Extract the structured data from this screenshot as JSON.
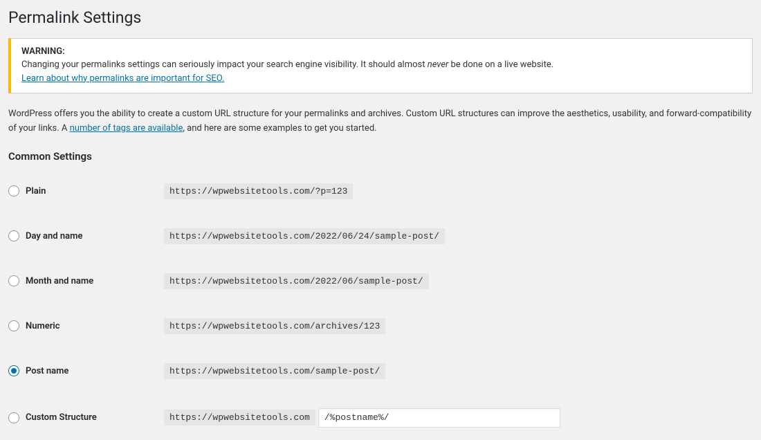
{
  "page_title": "Permalink Settings",
  "notice": {
    "title": "WARNING:",
    "body_before": "Changing your permalinks settings can seriously impact your search engine visibility. It should almost ",
    "body_em": "never",
    "body_after": " be done on a live website.",
    "link_text": "Learn about why permalinks are important for SEO."
  },
  "intro": {
    "before": "WordPress offers you the ability to create a custom URL structure for your permalinks and archives. Custom URL structures can improve the aesthetics, usability, and forward-compatibility of your links. A ",
    "link": "number of tags are available",
    "after": ", and here are some examples to get you started."
  },
  "section_title": "Common Settings",
  "options": {
    "plain": {
      "label": "Plain",
      "example": "https://wpwebsitetools.com/?p=123"
    },
    "day_name": {
      "label": "Day and name",
      "example": "https://wpwebsitetools.com/2022/06/24/sample-post/"
    },
    "month_name": {
      "label": "Month and name",
      "example": "https://wpwebsitetools.com/2022/06/sample-post/"
    },
    "numeric": {
      "label": "Numeric",
      "example": "https://wpwebsitetools.com/archives/123"
    },
    "post_name": {
      "label": "Post name",
      "example": "https://wpwebsitetools.com/sample-post/"
    },
    "custom": {
      "label": "Custom Structure",
      "prefix": "https://wpwebsitetools.com",
      "value": "/%postname%/"
    }
  },
  "selected": "post_name"
}
